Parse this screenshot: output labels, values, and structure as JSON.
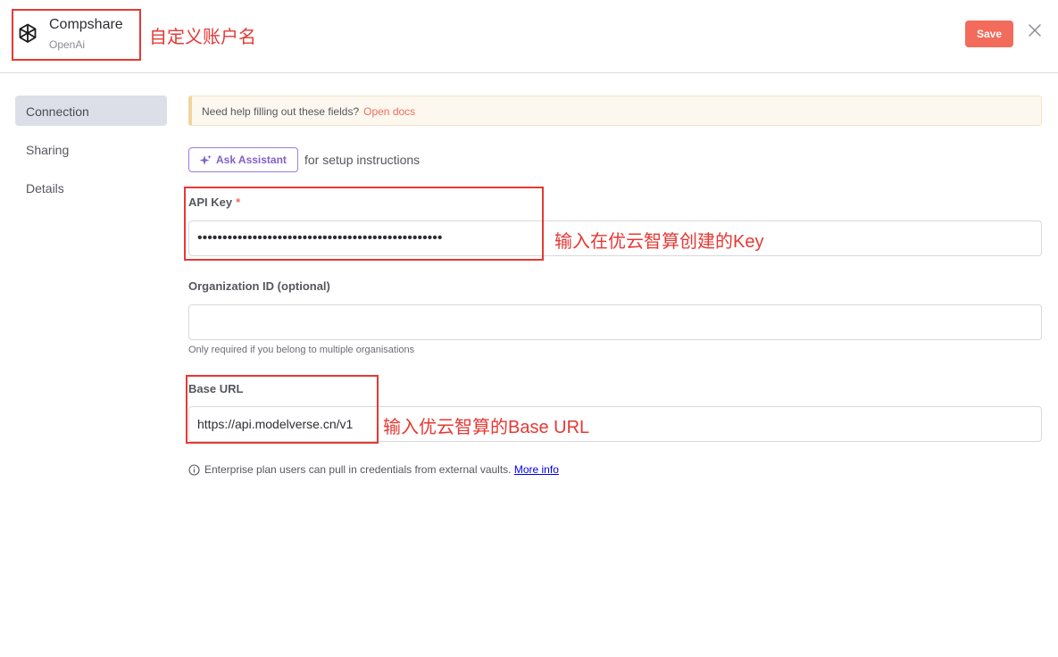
{
  "header": {
    "title": "Compshare",
    "subtitle": "OpenAi",
    "save_label": "Save",
    "icon": "openai-logo-icon",
    "close_icon": "close-icon"
  },
  "sidebar": {
    "items": [
      {
        "label": "Connection",
        "active": true
      },
      {
        "label": "Sharing",
        "active": false
      },
      {
        "label": "Details",
        "active": false
      }
    ]
  },
  "notice": {
    "text": "Need help filling out these fields?",
    "link": "Open docs"
  },
  "assistant": {
    "button_label": "Ask Assistant",
    "suffix": "for setup instructions",
    "icon": "sparkle-icon"
  },
  "fields": {
    "api_key": {
      "label": "API Key",
      "required_mark": "*",
      "value": "•••••••••••••••••••••••••••••••••••••••••••••••••"
    },
    "organization_id": {
      "label": "Organization ID (optional)",
      "value": "",
      "hint": "Only required if you belong to multiple organisations"
    },
    "base_url": {
      "label": "Base URL",
      "value": "https://api.modelverse.cn/v1"
    }
  },
  "footer_info": {
    "text": "Enterprise plan users can pull in credentials from external vaults.",
    "link": "More info",
    "icon": "info-circle-icon"
  },
  "annotations": {
    "account_name": "自定义账户名",
    "api_key": "输入在优云智算创建的Key",
    "base_url": "输入优云智算的Base URL"
  },
  "colors": {
    "accent": "#f26b5b",
    "assistant": "#8060c8",
    "annotation": "#e53935",
    "sidebar_active": "#dcdfe8"
  }
}
